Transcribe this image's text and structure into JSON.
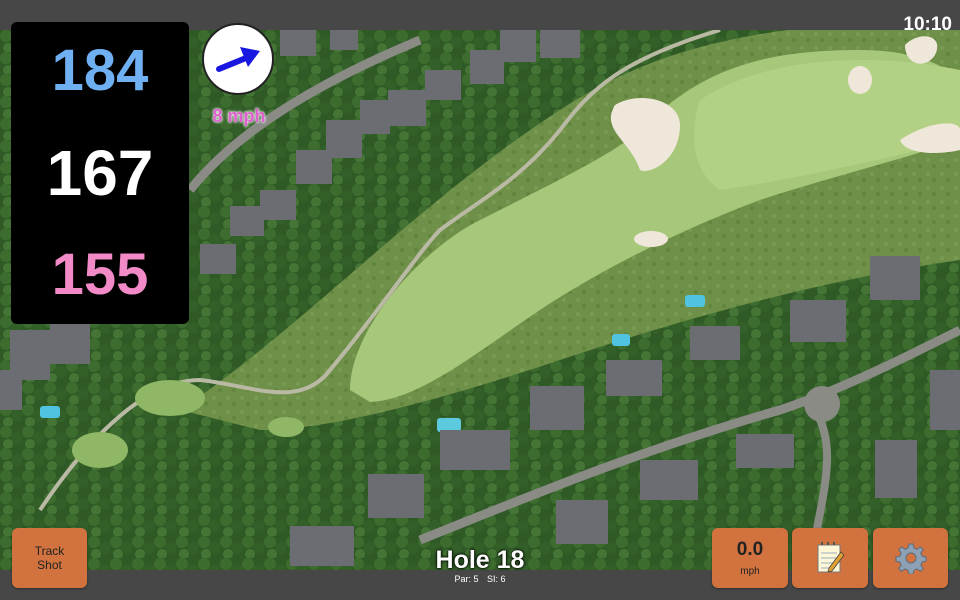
{
  "status": {
    "time": "10:10"
  },
  "distances": {
    "back": "184",
    "middle": "167",
    "front": "155"
  },
  "wind": {
    "speed": "8 mph",
    "arrow_icon": "wind-arrow-icon",
    "arrow_color": "#1818e0",
    "speed_color": "#e060d0"
  },
  "buttons": {
    "track_shot": {
      "line1": "Track",
      "line2": "Shot"
    },
    "speed": {
      "value": "0.0",
      "unit": "mph"
    },
    "notes_icon": "notepad-icon",
    "settings_icon": "gear-icon"
  },
  "hole": {
    "title": "Hole 18",
    "par": "Par: 5",
    "si": "SI: 6"
  },
  "colors": {
    "button": "#d2733f",
    "panel": "#000000",
    "back": "#6fb0f2",
    "front": "#f28ac8"
  }
}
